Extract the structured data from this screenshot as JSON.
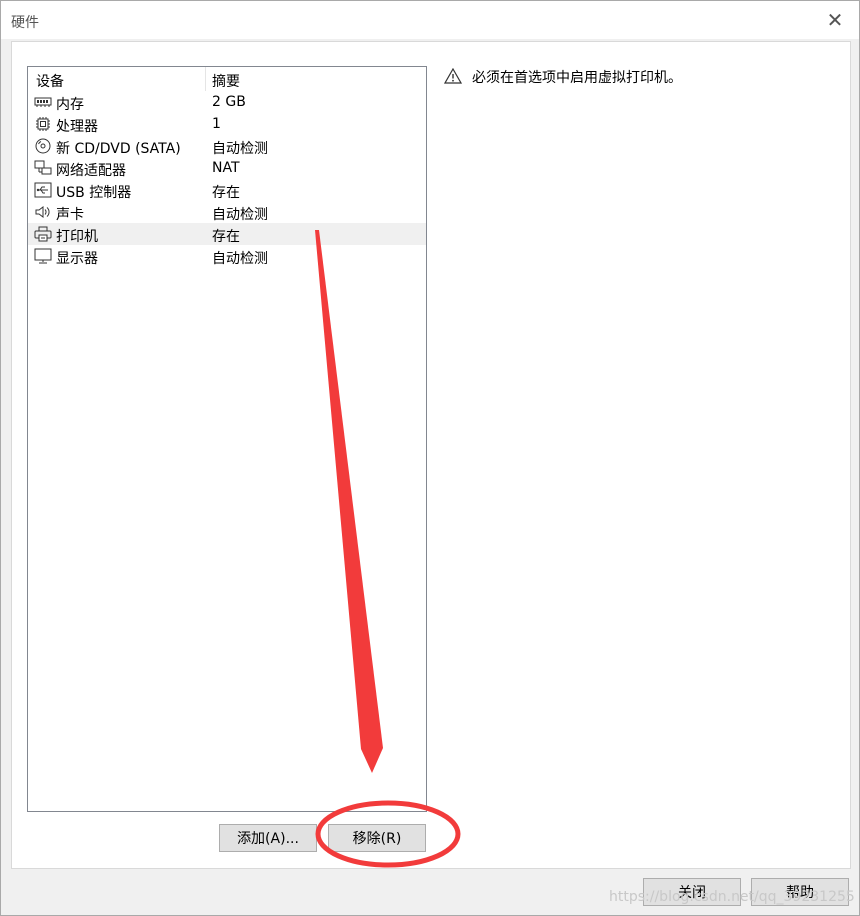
{
  "window": {
    "title": "硬件",
    "close_glyph": "✕"
  },
  "device_list": {
    "headers": {
      "device": "设备",
      "summary": "摘要"
    },
    "rows": [
      {
        "name": "内存",
        "value": "2 GB",
        "icon": "memory-icon"
      },
      {
        "name": "处理器",
        "value": "1",
        "icon": "cpu-icon"
      },
      {
        "name": "新 CD/DVD (SATA)",
        "value": "自动检测",
        "icon": "cd-dvd-icon"
      },
      {
        "name": "网络适配器",
        "value": "NAT",
        "icon": "network-adapter-icon"
      },
      {
        "name": "USB 控制器",
        "value": "存在",
        "icon": "usb-icon"
      },
      {
        "name": "声卡",
        "value": "自动检测",
        "icon": "speaker-icon"
      },
      {
        "name": "打印机",
        "value": "存在",
        "icon": "printer-icon",
        "selected": true
      },
      {
        "name": "显示器",
        "value": "自动检测",
        "icon": "monitor-icon"
      }
    ]
  },
  "actions": {
    "add_label": "添加(A)...",
    "remove_label": "移除(R)"
  },
  "warning": {
    "icon": "warning-icon",
    "text": "必须在首选项中启用虚拟打印机。"
  },
  "footer": {
    "close_label": "关闭",
    "help_label": "帮助"
  },
  "watermark": "https://blog.csdn.net/qq_39231255",
  "colors": {
    "annotation_red": "#f23b3b",
    "selection_bg": "#f0f0f0"
  }
}
